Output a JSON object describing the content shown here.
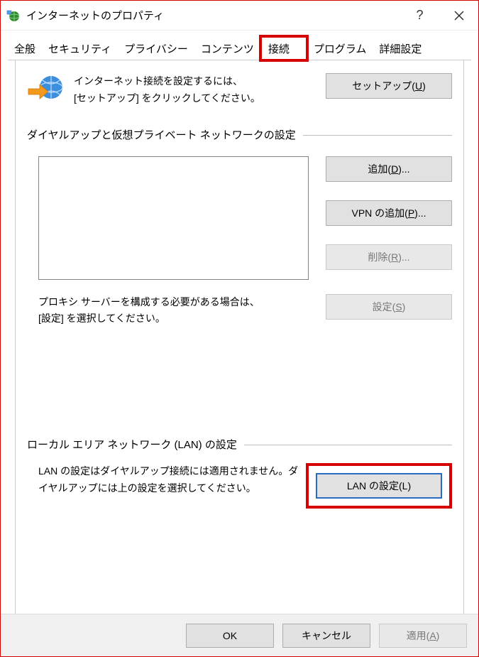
{
  "window": {
    "title": "インターネットのプロパティ"
  },
  "tabs": {
    "items": [
      {
        "label": "全般"
      },
      {
        "label": "セキュリティ"
      },
      {
        "label": "プライバシー"
      },
      {
        "label": "コンテンツ"
      },
      {
        "label": "接続",
        "active": true
      },
      {
        "label": "プログラム"
      },
      {
        "label": "詳細設定"
      }
    ]
  },
  "intro": {
    "line1": "インターネット接続を設定するには、",
    "line2": "[セットアップ] をクリックしてください。",
    "setup_label": "セットアップ(",
    "setup_key": "U",
    "setup_label_end": ")"
  },
  "dial": {
    "title": "ダイヤルアップと仮想プライベート ネットワークの設定",
    "add_label": "追加(",
    "add_key": "D",
    "add_label_end": ")...",
    "vpn_label": "VPN の追加(",
    "vpn_key": "P",
    "vpn_label_end": ")...",
    "remove_label": "削除(",
    "remove_key": "R",
    "remove_label_end": ")..."
  },
  "proxy": {
    "line1": "プロキシ サーバーを構成する必要がある場合は、",
    "line2": "[設定] を選択してください。",
    "settings_label": "設定(",
    "settings_key": "S",
    "settings_label_end": ")"
  },
  "lan": {
    "title": "ローカル エリア ネットワーク (LAN) の設定",
    "text": "LAN の設定はダイヤルアップ接続には適用されません。ダイヤルアップには上の設定を選択してください。",
    "button_label": "LAN の設定(",
    "button_key": "L",
    "button_label_end": ")"
  },
  "footer": {
    "ok": "OK",
    "cancel": "キャンセル",
    "apply_label": "適用(",
    "apply_key": "A",
    "apply_label_end": ")"
  }
}
